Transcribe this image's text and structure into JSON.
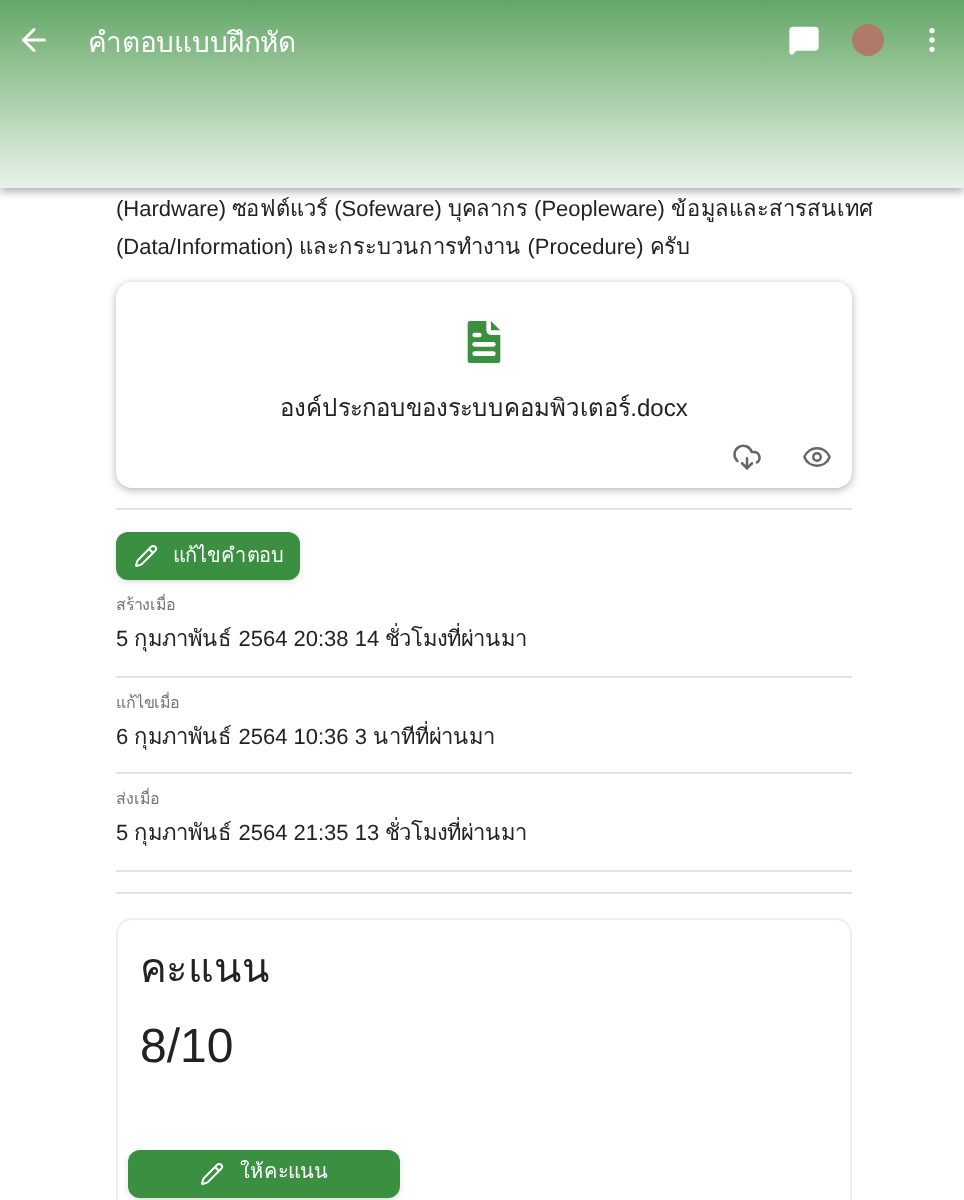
{
  "app_bar": {
    "title": "คำตอบแบบฝึกหัด"
  },
  "answer_text": [
    "(Hardware) ซอฟต์แวร์ (Sofeware) บุคลากร (Peopleware) ข้อมูลและสารสนเทศ",
    "(Data/Information) และกระบวนการทำงาน (Procedure) ครับ"
  ],
  "attachment": {
    "file_name": "องค์ประกอบของระบบคอมพิวเตอร์.docx"
  },
  "edit_button": "แก้ไขคำตอบ",
  "details": [
    {
      "label": "สร้างเมื่อ",
      "value": "5 กุมภาพันธ์ 2564 20:38 14 ชั่วโมงที่ผ่านมา"
    },
    {
      "label": "แก้ไขเมื่อ",
      "value": "6 กุมภาพันธ์ 2564 10:36 3 นาทีที่ผ่านมา"
    },
    {
      "label": "ส่งเมื่อ",
      "value": "5 กุมภาพันธ์ 2564 21:35 13 ชั่วโมงที่ผ่านมา"
    }
  ],
  "score": {
    "title": "คะแนน",
    "value": "8/10",
    "button": "ให้คะแนน"
  }
}
